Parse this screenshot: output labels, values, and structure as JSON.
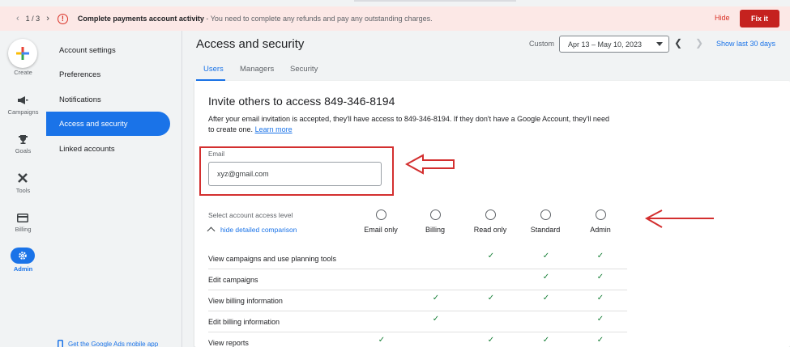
{
  "banner": {
    "pager": "1 / 3",
    "title": "Complete payments account activity",
    "message": " - You need to complete any refunds and pay any outstanding charges.",
    "hide_label": "Hide",
    "fix_label": "Fix it",
    "alert_glyph": "!"
  },
  "rail": {
    "create": "Create",
    "campaigns": "Campaigns",
    "goals": "Goals",
    "tools": "Tools",
    "billing": "Billing",
    "admin": "Admin"
  },
  "menu": {
    "items": [
      "Account settings",
      "Preferences",
      "Notifications",
      "Access and security",
      "Linked accounts"
    ],
    "active_index": 3,
    "footer": "Get the Google Ads mobile app"
  },
  "header": {
    "title": "Access and security",
    "custom_label": "Custom",
    "date_range": "Apr 13 – May 10, 2023",
    "show_last": "Show last 30 days"
  },
  "tabs": [
    "Users",
    "Managers",
    "Security"
  ],
  "invite": {
    "title": "Invite others to access 849-346-8194",
    "description": "After your email invitation is accepted, they'll have access to 849-346-8194. If they don't have a Google Account, they'll need to create one.",
    "learn_more": "Learn more",
    "email_label": "Email",
    "email_value": "xyz@gmail.com"
  },
  "access": {
    "label": "Select account access level",
    "toggle": "hide detailed comparison",
    "levels": [
      "Email only",
      "Billing",
      "Read only",
      "Standard",
      "Admin"
    ]
  },
  "permissions": [
    {
      "label": "View campaigns and use planning tools",
      "checks": [
        false,
        false,
        true,
        true,
        true
      ]
    },
    {
      "label": "Edit campaigns",
      "checks": [
        false,
        false,
        false,
        true,
        true
      ]
    },
    {
      "label": "View billing information",
      "checks": [
        false,
        true,
        true,
        true,
        true
      ]
    },
    {
      "label": "Edit billing information",
      "checks": [
        false,
        true,
        false,
        false,
        true
      ]
    },
    {
      "label": "View reports",
      "checks": [
        true,
        false,
        true,
        true,
        true
      ]
    }
  ],
  "check_glyph": "✓",
  "colors": {
    "accent": "#1a73e8",
    "alert": "#d93025",
    "fix_button": "#c5221f",
    "banner_bg": "#fce8e6",
    "check": "#188038",
    "annotation": "#d32f2f"
  }
}
